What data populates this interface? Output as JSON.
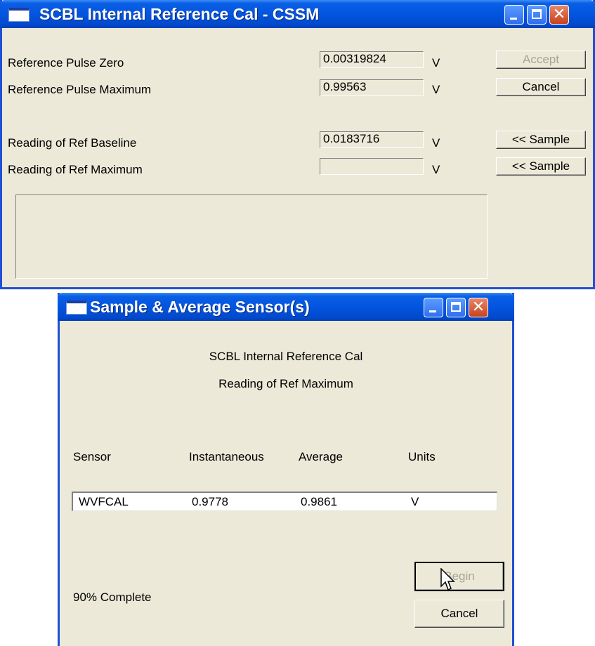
{
  "win1": {
    "title": "SCBL Internal Reference Cal - CSSM",
    "rows": [
      {
        "label": "Reference Pulse Zero",
        "value": "0.00319824",
        "unit": "V"
      },
      {
        "label": "Reference Pulse Maximum",
        "value": "0.99563",
        "unit": "V"
      },
      {
        "label": "Reading of Ref Baseline",
        "value": "0.0183716",
        "unit": "V"
      },
      {
        "label": "Reading of Ref Maximum",
        "value": "",
        "unit": "V"
      }
    ],
    "accept_label": "Accept",
    "cancel_label": "Cancel",
    "sample1_label": "<< Sample",
    "sample2_label": "<< Sample"
  },
  "win2": {
    "title": "Sample & Average Sensor(s)",
    "heading1": "SCBL Internal Reference Cal",
    "heading2": "Reading of Ref Maximum",
    "columns": [
      "Sensor",
      "Instantaneous",
      "Average",
      "Units"
    ],
    "row": {
      "sensor": "WVFCAL",
      "instantaneous": "0.9778",
      "average": "0.9861",
      "units": "V"
    },
    "progress_text": "90% Complete",
    "progress_percent": 90,
    "begin_label": "Begin",
    "cancel_label": "Cancel"
  },
  "icons": [
    "window-icon",
    "minimize-icon",
    "maximize-icon",
    "close-icon",
    "mouse-cursor-icon"
  ],
  "colors": {
    "titlebar": "#0355e0",
    "dialog_bg": "#ece9d8",
    "close_button": "#c9421d"
  }
}
